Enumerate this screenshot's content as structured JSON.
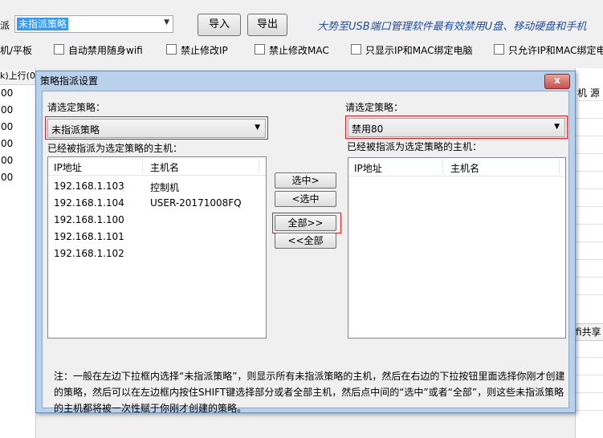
{
  "app": {
    "label_left": "派",
    "policy_combo": "未指派策略",
    "import_btn": "导入",
    "export_btn": "导出",
    "slogan": "大势至USB端口管理软件最有效禁用U盘、移动硬盘和手机",
    "checkboxes": [
      {
        "label": "机/平板",
        "checked": false
      },
      {
        "label": "自动禁用随身wifi",
        "checked": false
      },
      {
        "label": "禁止修改IP",
        "checked": false
      },
      {
        "label": "禁止修改MAC",
        "checked": false
      },
      {
        "label": "只显示IP和MAC绑定电脑",
        "checked": false
      },
      {
        "label": "只允许IP和MAC绑定电",
        "checked": false
      }
    ],
    "left_header": "k)上行(0.",
    "left_rows": [
      "00",
      "00",
      "00",
      "00",
      "00",
      "00"
    ],
    "right_header": "机  源",
    "right_mid_label": "fi共享"
  },
  "dialog": {
    "title": "策略指派设置",
    "close": "x",
    "left": {
      "select_label": "请选定策略：",
      "combo_value": "未指派策略",
      "hosts_label": "已经被指派为选定策略的主机：",
      "col_ip": "IP地址",
      "col_host": "主机名",
      "rows": [
        {
          "ip": "192.168.1.103",
          "host": "控制机"
        },
        {
          "ip": "192.168.1.104",
          "host": "USER-20171008FQ"
        },
        {
          "ip": "192.168.1.100",
          "host": ""
        },
        {
          "ip": "192.168.1.101",
          "host": ""
        },
        {
          "ip": "192.168.1.102",
          "host": ""
        }
      ]
    },
    "right": {
      "select_label": "请选定策略：",
      "combo_value": "禁用80",
      "hosts_label": "已经被指派为选定策略的主机：",
      "col_ip": "IP地址",
      "col_host": "主机名"
    },
    "buttons": {
      "add_selected": "选中>",
      "remove_selected": "<选中",
      "add_all": "全部>>",
      "remove_all": "<<全部"
    },
    "note": "注：一般在左边下拉框内选择“未指派策略”，则显示所有未指派策略的主机，然后在右边的下拉按钮里面选择你刚才创建的策略，然后可以在左边框内按住SHIFT键选择部分或者全部主机，然后点中间的“选中”或者“全部”，则这些未指派策略的主机都将被一次性赋于你刚才创建的策略。"
  }
}
